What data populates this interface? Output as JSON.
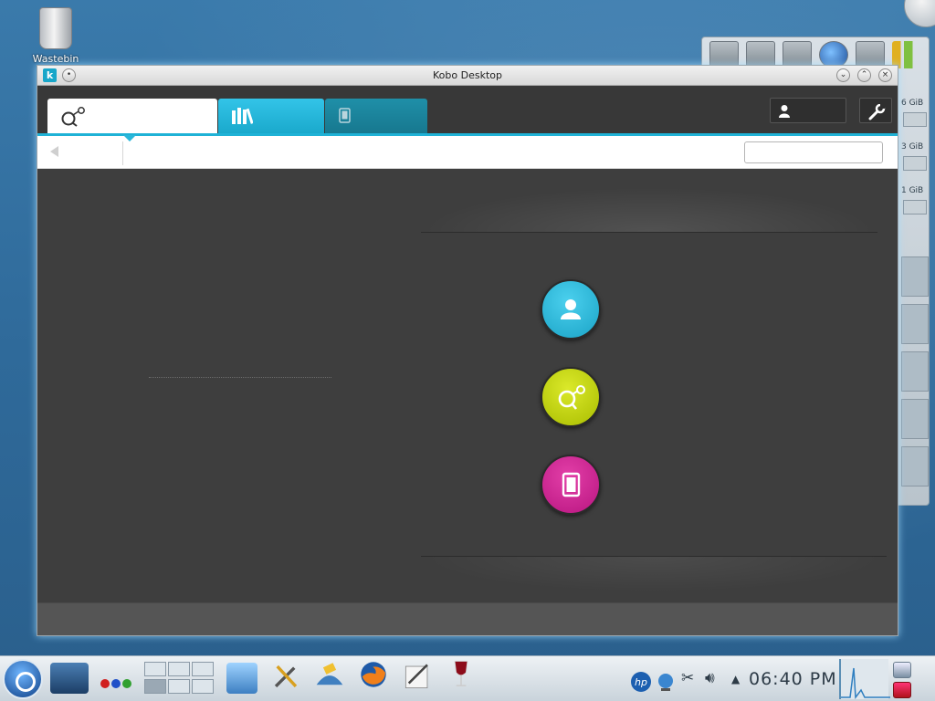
{
  "desktop": {
    "wastebin_label": "Wastebin"
  },
  "window": {
    "title": "Kobo Desktop",
    "app_badge": "k"
  },
  "tabs": [
    {
      "id": "discover",
      "icon": "discover-icon"
    },
    {
      "id": "library",
      "icon": "library-icon"
    },
    {
      "id": "device",
      "icon": "device-icon"
    }
  ],
  "search": {
    "value": "",
    "placeholder": ""
  },
  "system_monitor": {
    "memory_readouts": [
      "6 GiB",
      "3 GiB",
      "1 GiB"
    ]
  },
  "taskbar": {
    "clock": "06:40 PM"
  },
  "colors": {
    "accent": "#1fb2d6",
    "library_tab": "#33c4e8",
    "device_tab": "#1f8fa8",
    "account_button": "#1aa3c6",
    "discover_button": "#a9bd00",
    "device_button": "#b81580"
  }
}
